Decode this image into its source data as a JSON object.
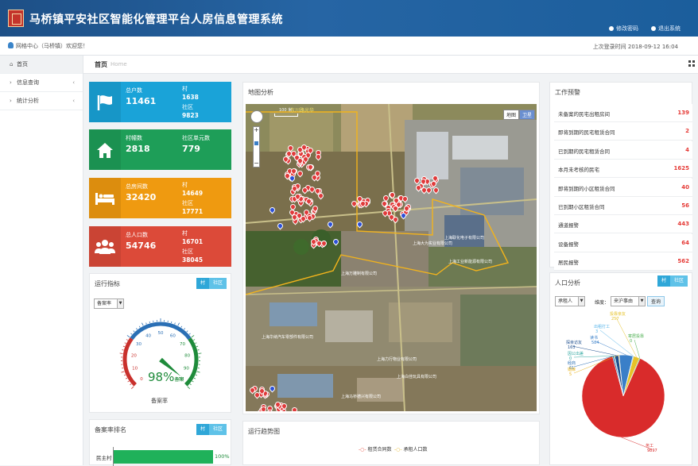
{
  "header": {
    "title": "马桥镇平安社区智能化管理平台人房信息管理系统",
    "change_password": "修改密码",
    "logout": "退出系统"
  },
  "subbar": {
    "welcome": "网格中心（马桥镇）欢迎您！",
    "last_login": "上次登录时间 2018-09-12 16:04"
  },
  "sidebar": {
    "items": [
      {
        "label": "首页"
      },
      {
        "label": "信息查询"
      },
      {
        "label": "统计分析"
      }
    ]
  },
  "breadcrumb": {
    "title": "首页",
    "sub": "Home"
  },
  "tiles": [
    {
      "label1": "总户数",
      "value1": "11461",
      "label2": "村",
      "value2": "1638",
      "label3": "社区",
      "value3": "9823",
      "color": "#1aa3d8"
    },
    {
      "label1": "村幢数",
      "value1": "2818",
      "label2": "社区单元数",
      "value2": "779",
      "color": "#1e9e58"
    },
    {
      "label1": "总房间数",
      "value1": "32420",
      "label2": "村",
      "value2": "14649",
      "label3": "社区",
      "value3": "17771",
      "color": "#ef9a10"
    },
    {
      "label1": "总人口数",
      "value1": "54746",
      "label2": "村",
      "value2": "16701",
      "label3": "社区",
      "value3": "38045",
      "color": "#dc4a39"
    }
  ],
  "run_indicator": {
    "title": "运行指标",
    "tog_a": "村",
    "tog_b": "社区",
    "select": "备案率",
    "gauge_value": "98%",
    "gauge_unit": "备案",
    "gauge_label": "备案率",
    "ticks": [
      "0",
      "10",
      "20",
      "30",
      "40",
      "50",
      "60",
      "70",
      "80",
      "90",
      "100"
    ]
  },
  "ranking": {
    "title": "备案率排名",
    "tog_a": "村",
    "tog_b": "社区",
    "row_label": "民主村",
    "row_value": "100%",
    "row_fraction": 1.0
  },
  "map_panel": {
    "title": "地图分析",
    "btn_map": "地图",
    "btn_sat": "卫星",
    "scale": "100 米",
    "zoom_in": "+",
    "zoom_out": "−",
    "labels": [
      "东川路光华",
      "上海大为实业有限公司",
      "上海联化电子有限公司",
      "上海万雕制有限公司",
      "上海工业新能源有限公司",
      "上海华纳汽车零部件有限公司",
      "上海力行物业有限公司",
      "上海白佳玩具有限公司",
      "上海马桥德兴有限公司"
    ]
  },
  "trend": {
    "title": "运行趋势图",
    "legend_a": "租赁合同数",
    "legend_b": "承租人口数"
  },
  "work_warning": {
    "title": "工作预警",
    "items": [
      {
        "label": "未备案的民宅出租房间",
        "value": "139"
      },
      {
        "label": "即将到期的民宅租赁合同",
        "value": "2"
      },
      {
        "label": "已到期的民宅租赁合同",
        "value": "4"
      },
      {
        "label": "本月未考核的民宅",
        "value": "1625"
      },
      {
        "label": "即将到期的小区租赁合同",
        "value": "40"
      },
      {
        "label": "已到期小区租赁合同",
        "value": "56"
      },
      {
        "label": "通道报警",
        "value": "443"
      },
      {
        "label": "设备报警",
        "value": "64"
      },
      {
        "label": "居民报警",
        "value": "562"
      }
    ]
  },
  "population": {
    "title": "人口分析",
    "tog_a": "村",
    "tog_b": "社区",
    "select1": "承租人",
    "dim_label": "维度：",
    "select2": "来沪事由",
    "query": "查询"
  },
  "chart_data": {
    "type": "pie",
    "title": "",
    "slices": [
      {
        "name": "务工",
        "value": 9897,
        "color": "#d92b2b"
      },
      {
        "name": "经商",
        "value": 61,
        "color": "#2b6fb5"
      },
      {
        "name": "因公出差",
        "value": 0,
        "color": "#2fa7a0"
      },
      {
        "name": "探亲访友",
        "value": 163,
        "color": "#1f4f8e"
      },
      {
        "name": "婚嫁",
        "value": 5,
        "color": "#e8b21b"
      },
      {
        "name": "读书",
        "value": 584,
        "color": "#3a7fc8"
      },
      {
        "name": "出租打工",
        "value": 3,
        "color": "#56b4e9"
      },
      {
        "name": "投靠亲友",
        "value": 257,
        "color": "#e6c229"
      },
      {
        "name": "寄居投靠",
        "value": 0,
        "color": "#4caf50"
      }
    ]
  }
}
